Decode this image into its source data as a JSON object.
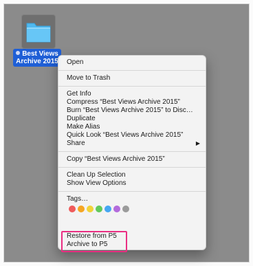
{
  "folder": {
    "label_line1": "Best Views",
    "label_line2": "Archive 2015",
    "folder_color": "#4fb9f0"
  },
  "menu": {
    "open": "Open",
    "trash": "Move to Trash",
    "get_info": "Get Info",
    "compress": "Compress “Best Views Archive 2015”",
    "burn": "Burn “Best Views Archive 2015” to Disc…",
    "duplicate": "Duplicate",
    "make_alias": "Make Alias",
    "quick_look": "Quick Look “Best Views Archive 2015”",
    "share": "Share",
    "copy": "Copy “Best Views Archive 2015”",
    "clean_up": "Clean Up Selection",
    "view_options": "Show View Options",
    "tags": "Tags…",
    "restore": "Restore from P5",
    "archive": "Archive to P5"
  },
  "tag_colors": [
    "#ef5b5b",
    "#f5a623",
    "#f0d43a",
    "#62c95c",
    "#45a7f2",
    "#b36bdc",
    "#9b9b9b"
  ],
  "highlight_color": "#ea2e82"
}
